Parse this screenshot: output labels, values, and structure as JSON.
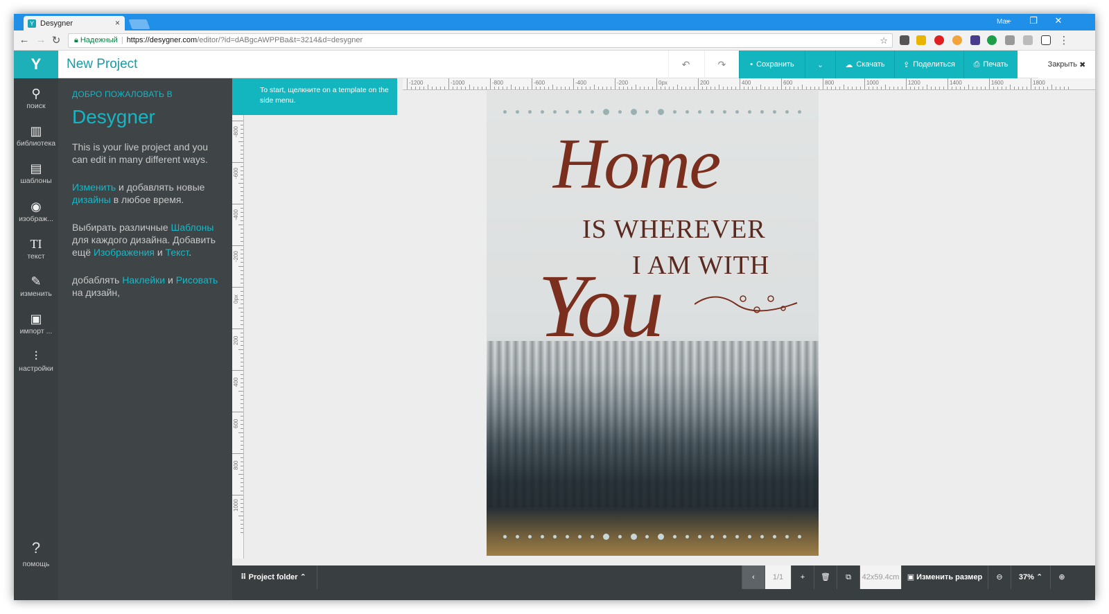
{
  "browser": {
    "tab_title": "Desygner",
    "tab_favicon": "Y",
    "user": "Max",
    "address": {
      "secure_label": "Надежный",
      "host": "https://desygner.com",
      "path": "/editor/?id=dABgcAWPPBa&t=3214&d=desygner"
    }
  },
  "app": {
    "logo": "Y",
    "project_title": "New Project",
    "toolbar": {
      "save": "Сохранить",
      "download": "Скачать",
      "share": "Поделиться",
      "print": "Печать",
      "close": "Закрыть"
    }
  },
  "rail": [
    {
      "label": "поиск",
      "icon": "search-icon",
      "glyph": "⚲"
    },
    {
      "label": "библиотека",
      "icon": "library-icon",
      "glyph": "▥"
    },
    {
      "label": "шаблоны",
      "icon": "templates-icon",
      "glyph": "▤"
    },
    {
      "label": "изображ...",
      "icon": "camera-icon",
      "glyph": "◉"
    },
    {
      "label": "текст",
      "icon": "text-icon",
      "glyph": "TI"
    },
    {
      "label": "изменить",
      "icon": "brush-icon",
      "glyph": "✎"
    },
    {
      "label": "импорт ...",
      "icon": "import-icon",
      "glyph": "▣"
    },
    {
      "label": "настройки",
      "icon": "settings-icon",
      "glyph": "⫶"
    }
  ],
  "help": {
    "label": "помощь",
    "glyph": "?"
  },
  "welcome": {
    "small": "ДОБРО ПОЖАЛОВАТЬ В",
    "brand": "Desygner",
    "p1": "This is your live project and you can edit in many different ways.",
    "p2_link1": "Изменить",
    "p2_mid": " и добавлять новые ",
    "p2_link2": "дизайны",
    "p2_end": " в любое время.",
    "p3_start": "Выбирать различные ",
    "p3_link1": "Шаблоны",
    "p3_mid1": " для каждого дизайна. Добавить ещё ",
    "p3_link2": "Изображения",
    "p3_mid2": " и ",
    "p3_link3": "Текст",
    "p3_end": ".",
    "p4_start": "добаблять ",
    "p4_link1": "Наклейки",
    "p4_mid": " и ",
    "p4_link2": "Рисовать",
    "p4_end": " на дизайн,"
  },
  "canvas": {
    "hint": "To start, щелкните on a template on the side menu.",
    "ruler_top": [
      "-1200",
      "-1000",
      "-800",
      "-600",
      "-400",
      "-200",
      "0px",
      "200",
      "400",
      "600",
      "800",
      "1000",
      "1200",
      "1400",
      "1600",
      "1800"
    ],
    "ruler_left": [
      "-800",
      "-600",
      "-400",
      "-200",
      "0px",
      "200",
      "400",
      "600",
      "800",
      "1000"
    ]
  },
  "poster": {
    "line1": "Home",
    "line2": "IS WHEREVER",
    "line3": "I AM WITH",
    "line4": "You"
  },
  "bottom": {
    "project_folder": "Project folder",
    "page_indicator": "1/1",
    "size": "42x59.4cm",
    "resize": "Изменить размер",
    "zoom": "37%"
  },
  "colors": {
    "accent": "#13b6be",
    "rail_bg": "#393e41",
    "panel_bg": "#3f4447",
    "poster_text": "#7a2e1d"
  }
}
